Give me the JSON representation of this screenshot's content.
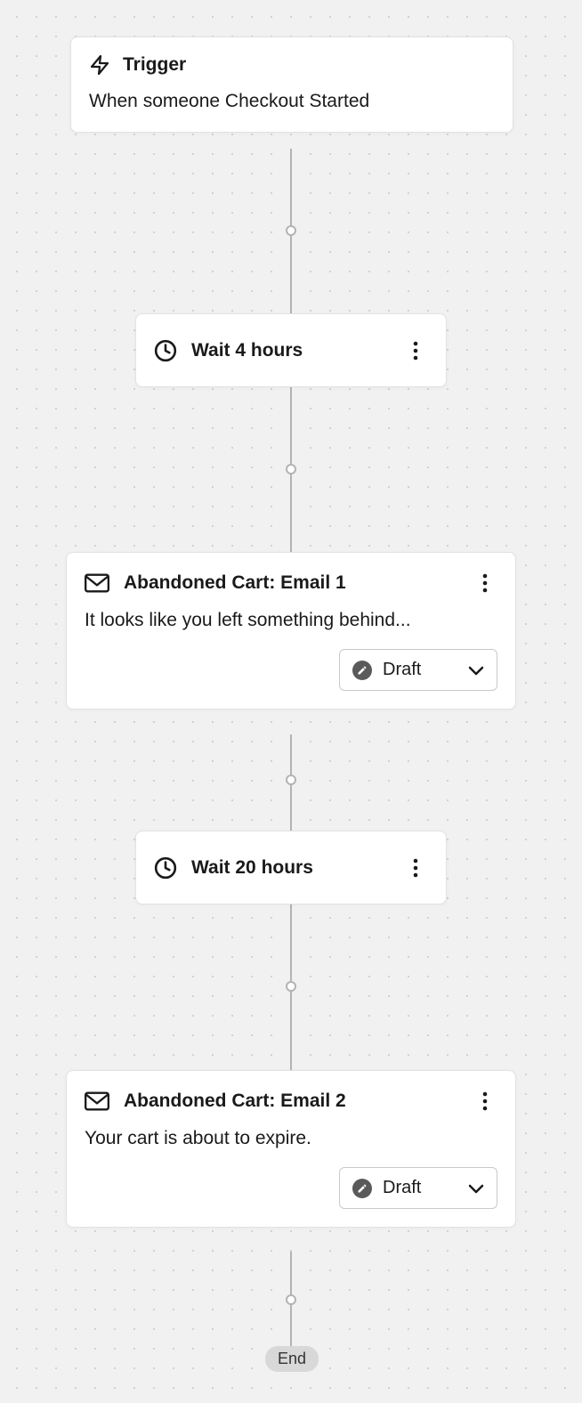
{
  "trigger": {
    "title": "Trigger",
    "description": "When someone Checkout Started"
  },
  "steps": [
    {
      "type": "wait",
      "label": "Wait 4 hours"
    },
    {
      "type": "email",
      "title": "Abandoned Cart: Email 1",
      "subject": "It looks like you left something behind...",
      "status": "Draft"
    },
    {
      "type": "wait",
      "label": "Wait 20 hours"
    },
    {
      "type": "email",
      "title": "Abandoned Cart: Email 2",
      "subject": "Your cart is about to expire.",
      "status": "Draft"
    }
  ],
  "end_label": "End"
}
